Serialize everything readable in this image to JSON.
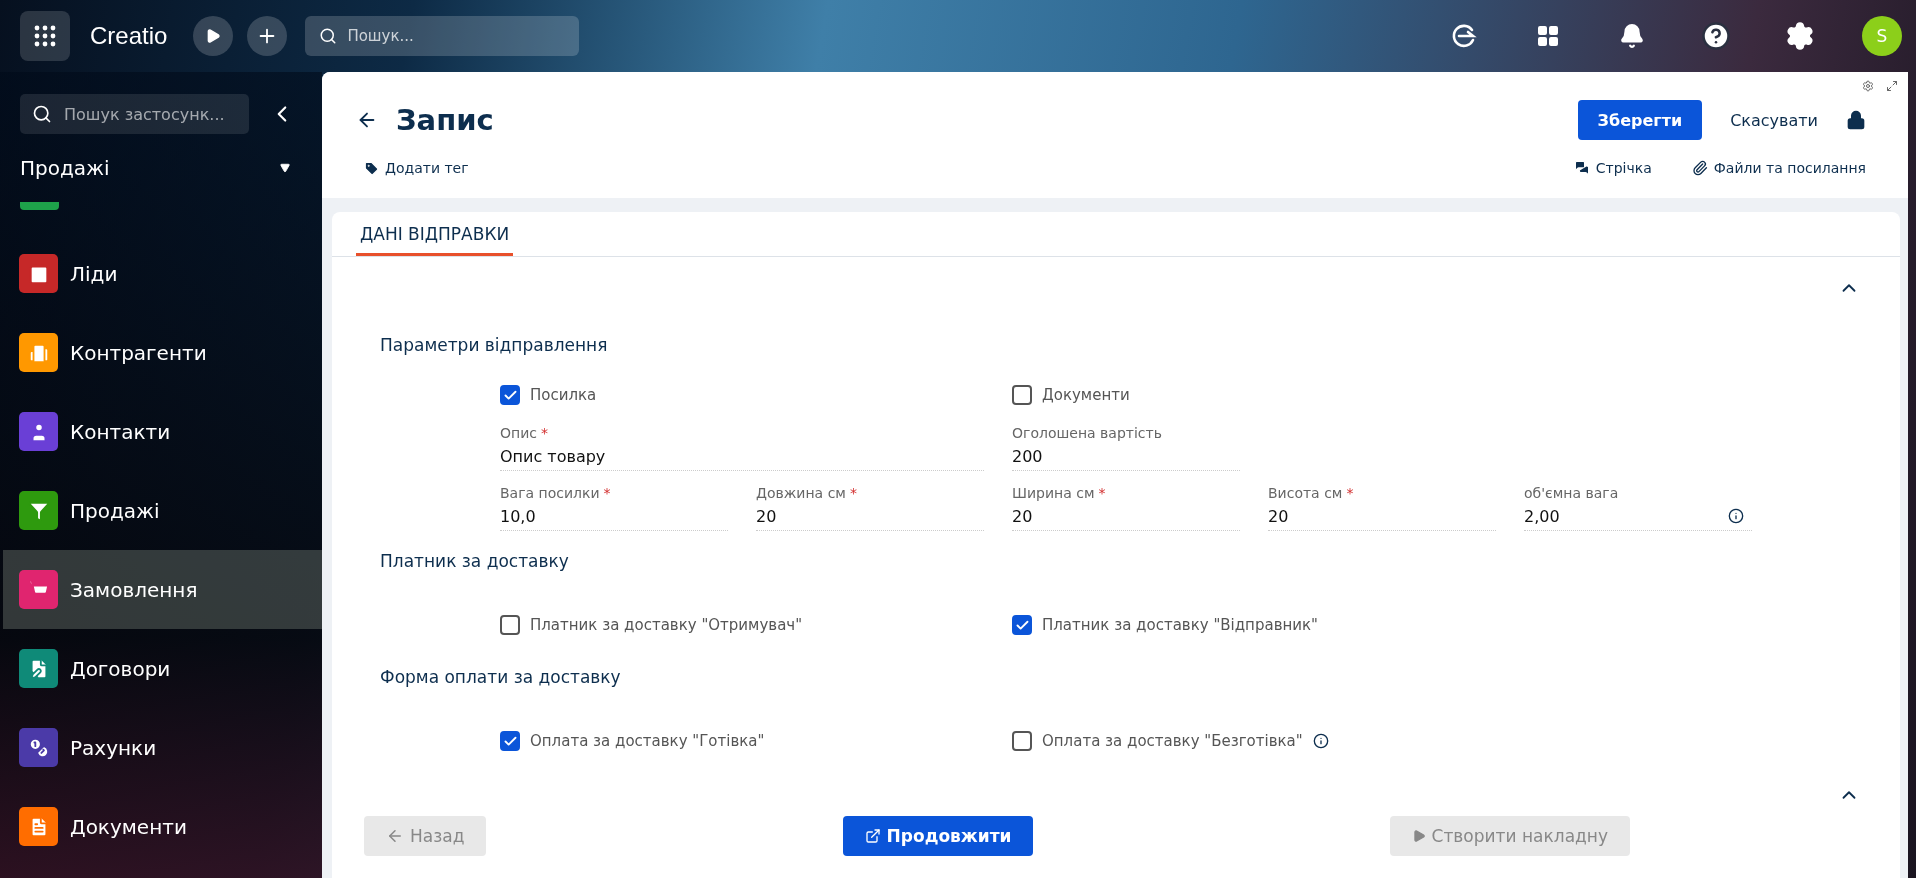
{
  "topbar": {
    "logo": "Creatio",
    "search": {
      "placeholder": "Пошук..."
    },
    "avatar": "S"
  },
  "sidebar": {
    "search": {
      "placeholder": "Пошук застосунк..."
    },
    "workplace": "Продажі",
    "items": [
      {
        "label": "Ліди",
        "color": "#c62828",
        "selected": false
      },
      {
        "label": "Контрагенти",
        "color": "#ff9800",
        "selected": false
      },
      {
        "label": "Контакти",
        "color": "#6a3fd6",
        "selected": false
      },
      {
        "label": "Продажі",
        "color": "#2e9a0e",
        "selected": false
      },
      {
        "label": "Замовлення",
        "color": "#e0256f",
        "selected": true
      },
      {
        "label": "Договори",
        "color": "#0f8a78",
        "selected": false
      },
      {
        "label": "Рахунки",
        "color": "#4b3aa8",
        "selected": false
      },
      {
        "label": "Документи",
        "color": "#ff6d00",
        "selected": false
      }
    ]
  },
  "record": {
    "title": "Запис",
    "tag_button": "Додати тег",
    "save": "Зберегти",
    "cancel": "Скасувати",
    "links": [
      "Стрічка",
      "Файли та посилання"
    ]
  },
  "tabs": [
    {
      "label": "ДАНІ ВІДПРАВКИ",
      "selected": true
    }
  ],
  "sections": [
    {
      "title": "Параметри відправлення",
      "rows": [
        {
          "kind": "checkboxes",
          "items": [
            {
              "label": "Посилка",
              "checked": true
            },
            {
              "label": "Документи",
              "checked": false
            }
          ]
        },
        {
          "kind": "fields",
          "items": [
            {
              "label": "Опис",
              "required_mark": "*",
              "value": "Опис товару",
              "wide": true
            },
            {
              "label": "Оголошена вартість",
              "value": "200",
              "wide": false
            }
          ]
        },
        {
          "kind": "fields",
          "items": [
            {
              "label": "Вага посилки",
              "required_mark": "*",
              "value": "10,0",
              "wide": false
            },
            {
              "label": "Довжина см",
              "required_mark": "*",
              "value": "20",
              "wide": false
            },
            {
              "label": "Ширина см",
              "required_mark": "*",
              "value": "20",
              "wide": false
            },
            {
              "label": "Висота см",
              "required_mark": "*",
              "value": "20",
              "wide": false
            },
            {
              "label": "об'ємна вага",
              "value": "2,00",
              "wide": false,
              "info": true
            }
          ]
        }
      ]
    },
    {
      "title": "Платник за доставку",
      "rows": [
        {
          "kind": "checkboxes",
          "items": [
            {
              "label": "Платник за доставку \"Отримувач\"",
              "checked": false
            },
            {
              "label": "Платник за доставку \"Відправник\"",
              "checked": true
            }
          ]
        }
      ]
    },
    {
      "title": "Форма оплати за доставку",
      "rows": [
        {
          "kind": "checkboxes",
          "items": [
            {
              "label": "Оплата за доставку \"Готівка\"",
              "checked": true
            },
            {
              "label": "Оплата за доставку \"Безготівка\"",
              "checked": false,
              "info": true
            }
          ]
        }
      ]
    }
  ],
  "footer": [
    {
      "label": "Назад",
      "kind": "back",
      "disabled": true
    },
    {
      "label": "Продовжити",
      "kind": "continue",
      "disabled": false
    },
    {
      "label": "Створити накладну",
      "kind": "create",
      "disabled": true
    }
  ]
}
